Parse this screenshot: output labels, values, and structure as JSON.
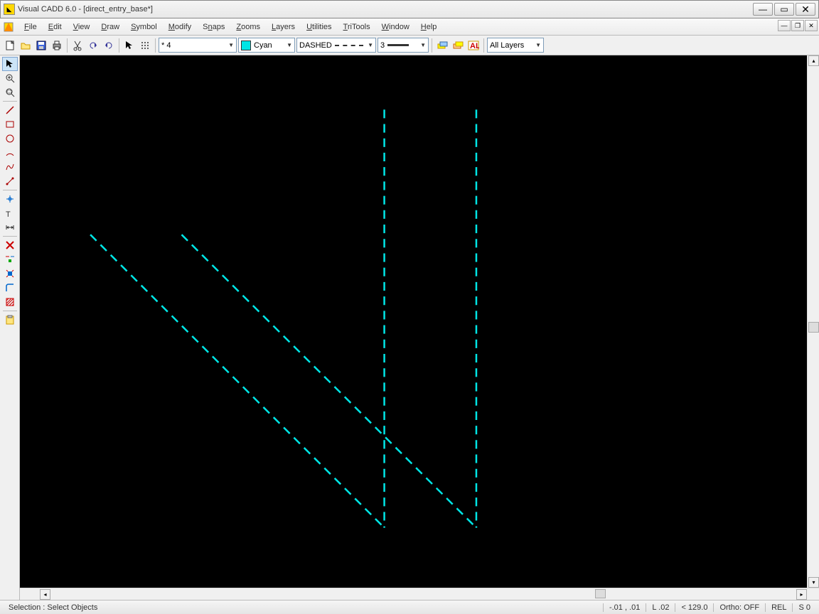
{
  "window": {
    "title": "Visual CADD 6.0 - [direct_entry_base*]"
  },
  "menu": {
    "items": [
      "File",
      "Edit",
      "View",
      "Draw",
      "Symbol",
      "Modify",
      "Snaps",
      "Zooms",
      "Layers",
      "Utilities",
      "TriTools",
      "Window",
      "Help"
    ]
  },
  "toolbar": {
    "point": "* 4",
    "color": "Cyan",
    "linetype": "DASHED",
    "lineweight": "3",
    "layer": "All Layers"
  },
  "statusbar": {
    "prompt": "Selection : Select Objects",
    "coords": "-.01 ,  .01",
    "length": "L .02",
    "angle": "< 129.0",
    "ortho": "Ortho: OFF",
    "mode": "REL",
    "snap": "S 0"
  }
}
